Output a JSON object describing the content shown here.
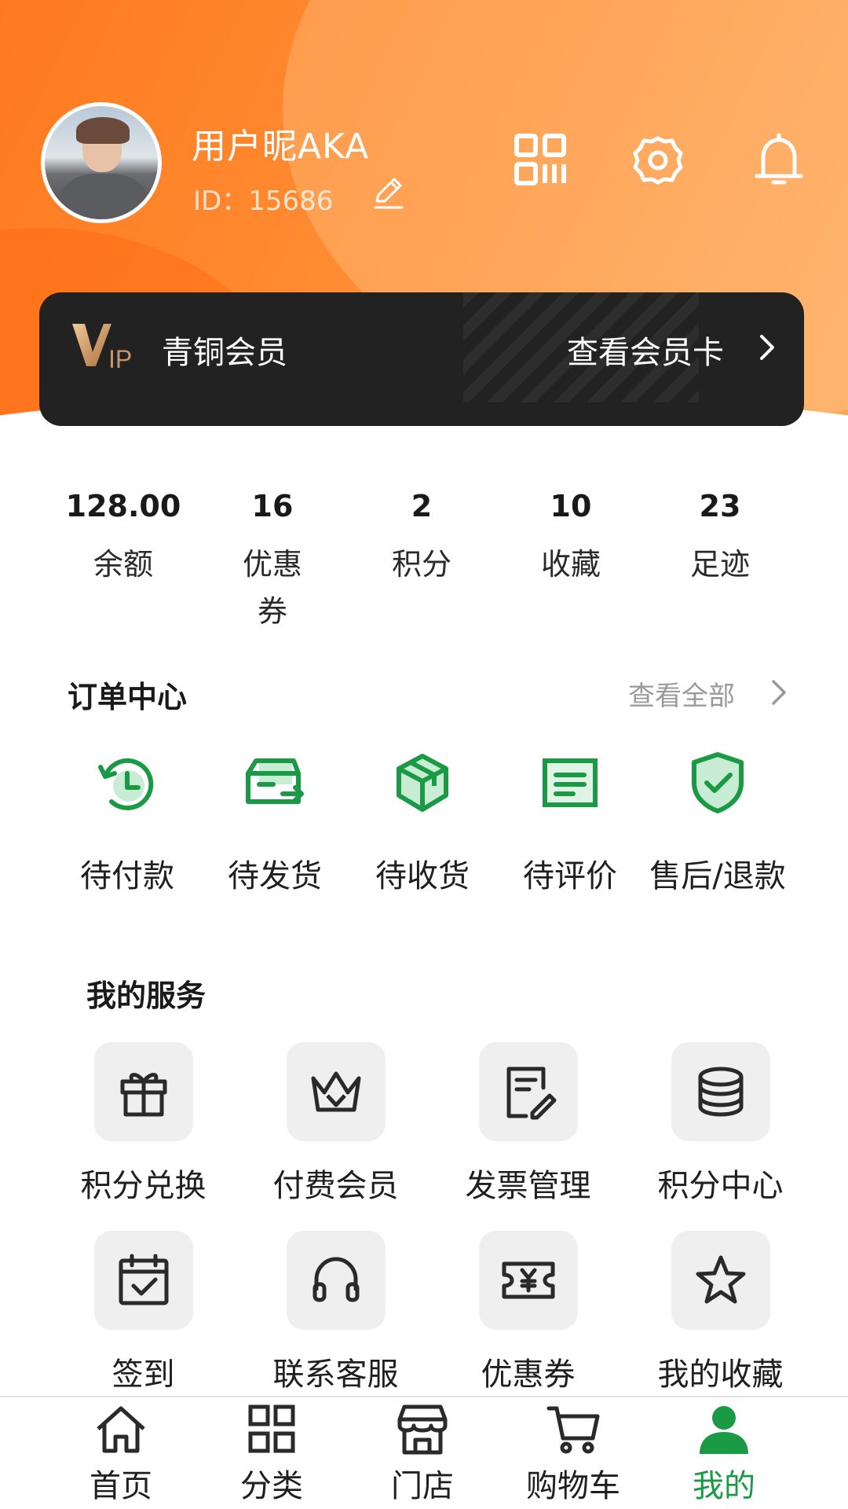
{
  "profile": {
    "nickname": "用户昵AKA",
    "user_id": "ID：15686"
  },
  "header_icons": [
    "edit-icon",
    "qr-code-icon",
    "settings-icon",
    "bell-icon"
  ],
  "vip": {
    "logo_text": "VIP",
    "level": "青铜会员",
    "link_label": "查看会员卡"
  },
  "stats": [
    {
      "value": "128.00",
      "label": "余额"
    },
    {
      "value": "16",
      "label": "优惠券"
    },
    {
      "value": "2",
      "label": "积分"
    },
    {
      "value": "10",
      "label": "收藏"
    },
    {
      "value": "23",
      "label": "足迹"
    }
  ],
  "orders": {
    "title": "订单中心",
    "view_all": "查看全部",
    "items": [
      {
        "label": "待付款",
        "icon": "pending-payment-icon"
      },
      {
        "label": "待发货",
        "icon": "pending-shipment-icon"
      },
      {
        "label": "待收货",
        "icon": "pending-receipt-icon"
      },
      {
        "label": "待评价",
        "icon": "pending-review-icon"
      },
      {
        "label": "售后/退款",
        "icon": "after-sales-icon"
      }
    ]
  },
  "services": {
    "title": "我的服务",
    "items": [
      {
        "label": "积分兑换",
        "icon": "gift-icon"
      },
      {
        "label": "付费会员",
        "icon": "crown-icon"
      },
      {
        "label": "发票管理",
        "icon": "invoice-icon"
      },
      {
        "label": "积分中心",
        "icon": "coins-icon"
      },
      {
        "label": "签到",
        "icon": "calendar-check-icon"
      },
      {
        "label": "联系客服",
        "icon": "headset-icon"
      },
      {
        "label": "优惠券",
        "icon": "coupon-icon"
      },
      {
        "label": "我的收藏",
        "icon": "star-icon"
      }
    ]
  },
  "bottom_nav": [
    {
      "label": "首页",
      "icon": "home-icon"
    },
    {
      "label": "分类",
      "icon": "category-icon"
    },
    {
      "label": "门店",
      "icon": "store-icon"
    },
    {
      "label": "购物车",
      "icon": "cart-icon"
    },
    {
      "label": "我的",
      "icon": "user-icon",
      "active": true
    }
  ],
  "colors": {
    "header_orange": "#ff8c33",
    "accent_green": "#1a9a44",
    "vip_card": "#222222",
    "vip_gold": "#c8956a"
  }
}
